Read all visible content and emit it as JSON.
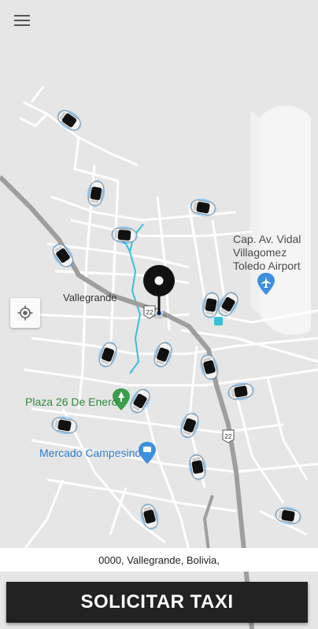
{
  "header": {
    "menu_icon": "hamburger-menu-icon"
  },
  "map": {
    "town_label": "Vallegrande",
    "airport_label_line1": "Cap. Av. Vidal",
    "airport_label_line2": "Villagomez",
    "airport_label_line3": "Toledo Airport",
    "poi_plaza": "Plaza 26 De Enero",
    "poi_market": "Mercado Campesino",
    "route_shield_1": "22",
    "route_shield_2": "22",
    "locate_icon": "crosshair-locate-icon",
    "pin_icon": "map-pin-icon",
    "colors": {
      "map_bg": "#e6e6e6",
      "road": "#ffffff",
      "highway": "#9e9e9e",
      "river": "#39c0d8",
      "airport": "#f4f4f4"
    }
  },
  "address": {
    "text": "0000, Vallegrande, Bolivia,"
  },
  "actions": {
    "request_label": "SOLICITAR TAXI"
  }
}
